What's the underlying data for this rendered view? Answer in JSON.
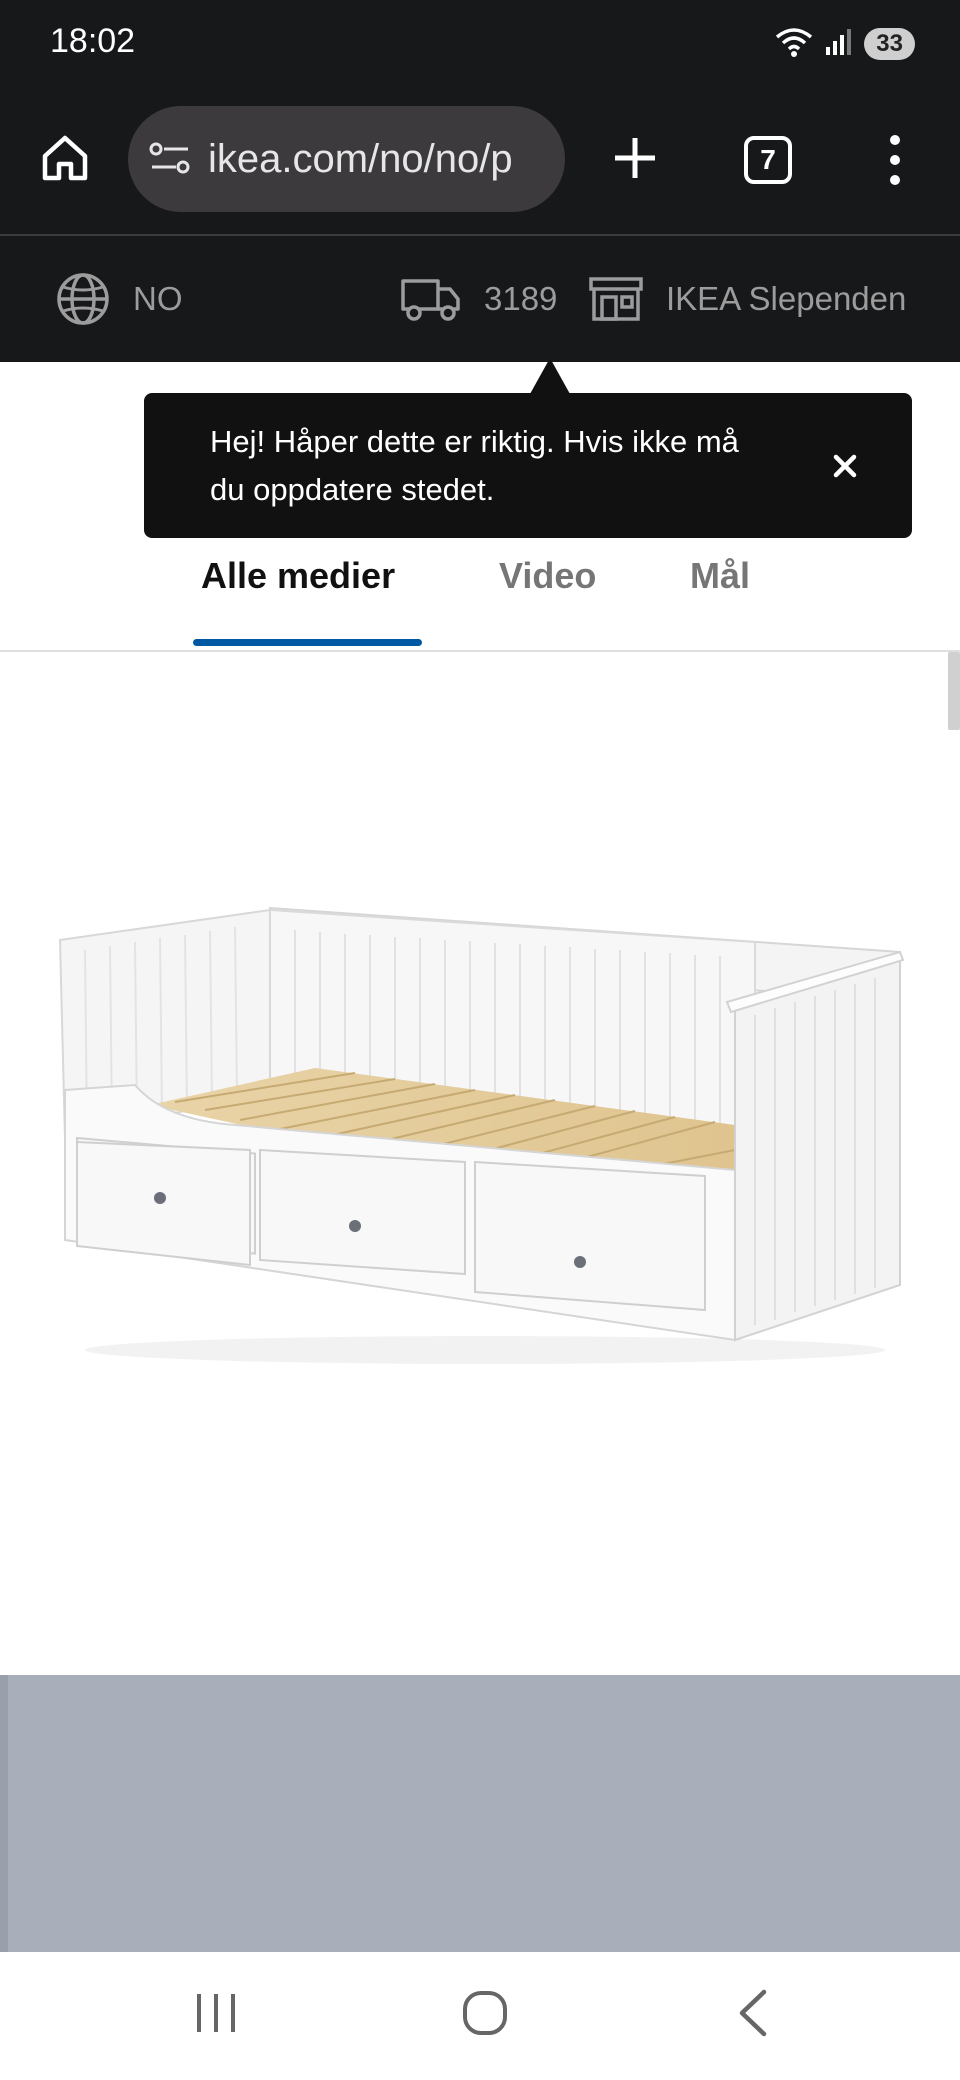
{
  "status_bar": {
    "time": "18:02",
    "battery": "33",
    "icons": [
      "wifi-icon",
      "signal-icon",
      "battery-icon"
    ]
  },
  "browser": {
    "url": "ikea.com/no/no/p",
    "tab_count": "7",
    "icons": [
      "home-icon",
      "site-settings-icon",
      "plus-icon",
      "tabs-icon",
      "more-menu-icon"
    ]
  },
  "utility_bar": {
    "country": "NO",
    "postal_code": "3189",
    "store": "IKEA Slependen",
    "icons": [
      "globe-icon",
      "truck-icon",
      "store-icon"
    ]
  },
  "tooltip": {
    "text": "Hej! Håper dette er riktig. Hvis ikke må du oppdatere stedet.",
    "icons": [
      "close-icon"
    ]
  },
  "media_tabs": {
    "items": [
      "Alle medier",
      "Video",
      "Mål"
    ],
    "active": "Alle medier",
    "accent_color": "#0058a3"
  },
  "navigation": {
    "icons": [
      "recent-apps-icon",
      "home-nav-icon",
      "back-icon"
    ]
  }
}
